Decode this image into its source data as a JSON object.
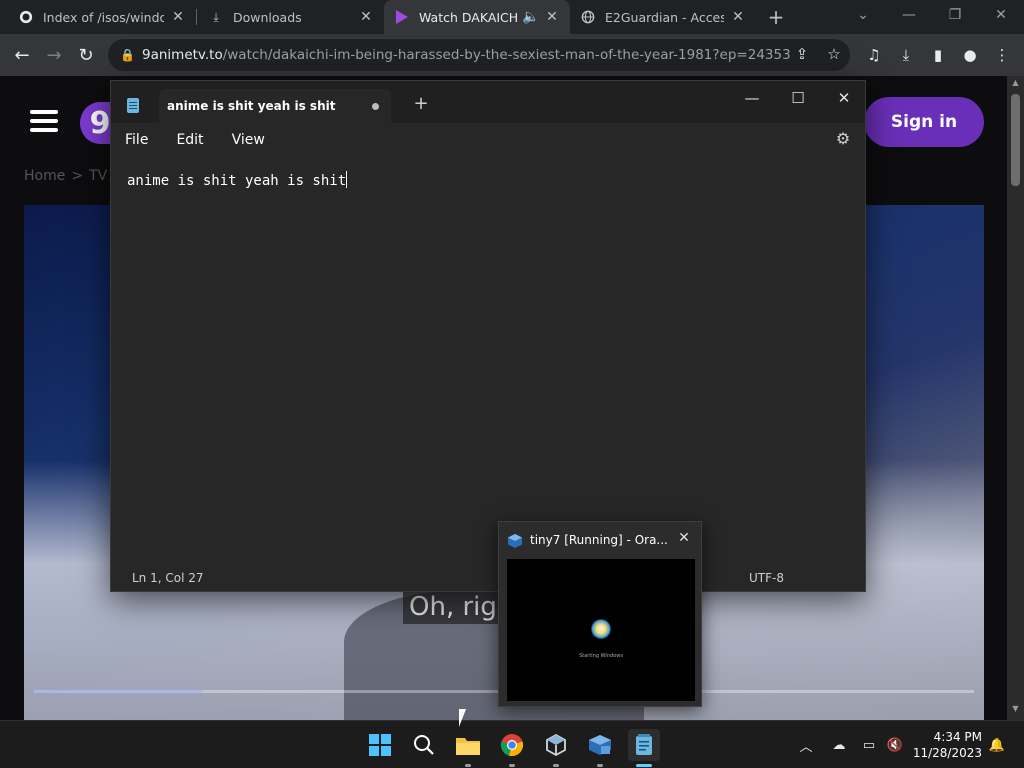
{
  "browser": {
    "tabs": [
      {
        "title": "Index of /isos/window",
        "icon": "github-icon",
        "active": false
      },
      {
        "title": "Downloads",
        "icon": "download-icon",
        "active": false
      },
      {
        "title": "Watch DAKAICHI",
        "icon": "play-icon",
        "active": true,
        "audio": true
      },
      {
        "title": "E2Guardian - Access D",
        "icon": "globe-icon",
        "active": false
      }
    ],
    "url_host": "9animetv.to",
    "url_path": "/watch/dakaichi-im-being-harassed-by-the-sexiest-man-of-the-year-1981?ep=24353"
  },
  "site": {
    "logo_text": "9",
    "sign_in": "Sign in",
    "breadcrumb": [
      "Home",
      ">",
      "TV"
    ],
    "subtitle": "Oh, righ",
    "progress": 0.18
  },
  "notepad": {
    "tab_title": "anime is shit yeah is shit",
    "menu": [
      "File",
      "Edit",
      "View"
    ],
    "text": "anime is shit yeah is shit",
    "status_position": "Ln 1, Col 27",
    "status_encoding": "UTF-8"
  },
  "thumbnail": {
    "title": "tiny7 [Running] - Ora...",
    "boot_text": "Starting Windows"
  },
  "taskbar": {
    "time": "4:34 PM",
    "date": "11/28/2023"
  },
  "colors": {
    "accent": "#60cdff",
    "site_button": "#6a2fb8"
  }
}
